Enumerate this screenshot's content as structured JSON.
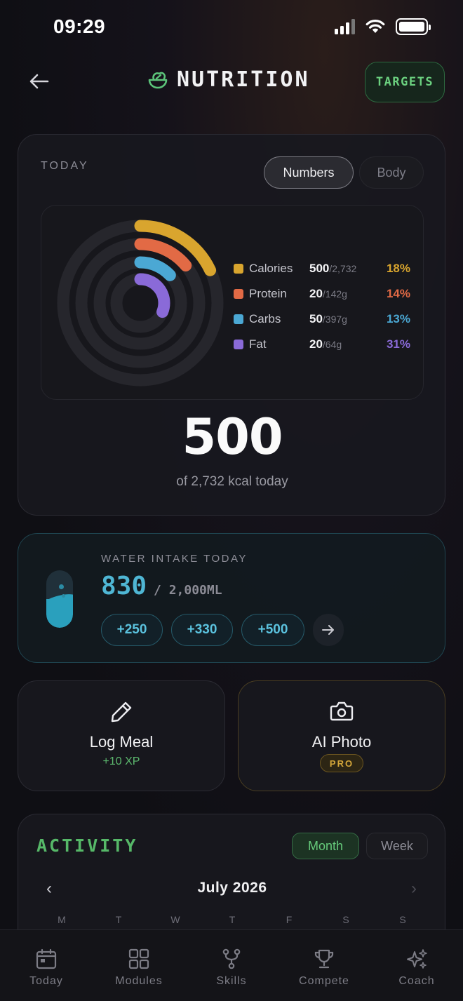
{
  "status_bar": {
    "time": "09:29"
  },
  "header": {
    "title": "NUTRITION",
    "targets_label": "TARGETS"
  },
  "today": {
    "label": "TODAY",
    "view_options": [
      "Numbers",
      "Body"
    ],
    "selected_view": "Numbers",
    "macros": [
      {
        "name": "Calories",
        "current": "500",
        "target": "/2,732",
        "percent": "18%",
        "fraction": 0.18,
        "color": "#d9a52e"
      },
      {
        "name": "Protein",
        "current": "20",
        "target": "/142g",
        "percent": "14%",
        "fraction": 0.14,
        "color": "#e26a45"
      },
      {
        "name": "Carbs",
        "current": "50",
        "target": "/397g",
        "percent": "13%",
        "fraction": 0.13,
        "color": "#4ba8d4"
      },
      {
        "name": "Fat",
        "current": "20",
        "target": "/64g",
        "percent": "31%",
        "fraction": 0.31,
        "color": "#8a6ad8"
      }
    ],
    "big_number": "500",
    "big_sub": "of 2,732 kcal today"
  },
  "water": {
    "title": "WATER INTAKE TODAY",
    "current": "830",
    "goal": "/ 2,000ML",
    "fill_fraction": 0.415,
    "quick_add": [
      "+250",
      "+330",
      "+500"
    ]
  },
  "actions": {
    "log_meal": {
      "title": "Log Meal",
      "sub": "+10 XP"
    },
    "ai_photo": {
      "title": "AI Photo",
      "badge": "PRO"
    }
  },
  "activity": {
    "title": "ACTIVITY",
    "views": [
      "Month",
      "Week"
    ],
    "selected_view": "Month",
    "month": "July 2026",
    "prev": "‹",
    "next": "›",
    "weekdays": [
      "M",
      "T",
      "W",
      "T",
      "F",
      "S",
      "S"
    ]
  },
  "tabs": [
    {
      "label": "Today",
      "icon": "calendar-icon"
    },
    {
      "label": "Modules",
      "icon": "grid-icon"
    },
    {
      "label": "Skills",
      "icon": "branch-icon"
    },
    {
      "label": "Compete",
      "icon": "trophy-icon"
    },
    {
      "label": "Coach",
      "icon": "sparkles-icon"
    }
  ],
  "colors": {
    "accent_green": "#56b868",
    "water_blue": "#4fb6d4",
    "pro_gold": "#d5a73a"
  }
}
